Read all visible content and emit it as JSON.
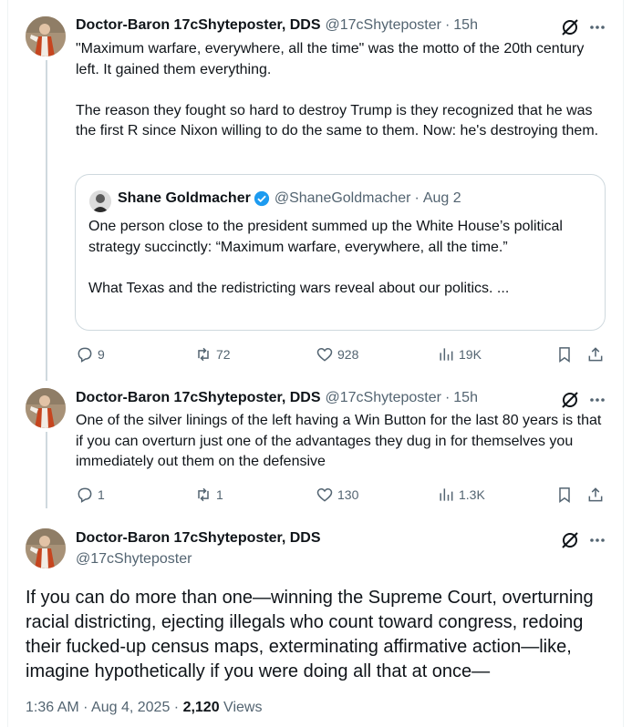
{
  "tweets": [
    {
      "name": "Doctor-Baron 17cShyteposter, DDS",
      "handle": "@17cShyteposter",
      "sep": "·",
      "time": "15h",
      "text": "\"Maximum warfare, everywhere, all the time\" was the motto of the 20th century left. It gained them everything.\n\nThe reason they fought so hard to destroy Trump is they recognized that he was the first R since Nixon willing to do the same to them. Now: he's destroying them.",
      "quote": {
        "name": "Shane Goldmacher",
        "handle": "@ShaneGoldmacher",
        "sep": "·",
        "time": "Aug 2",
        "text": "One person close to the president summed up the White House’s political strategy succinctly: “Maximum warfare, everywhere, all the time.”\n\nWhat Texas and the redistricting wars reveal about our politics. ..."
      },
      "stats": {
        "replies": "9",
        "reposts": "72",
        "likes": "928",
        "views": "19K"
      }
    },
    {
      "name": "Doctor-Baron 17cShyteposter, DDS",
      "handle": "@17cShyteposter",
      "sep": "·",
      "time": "15h",
      "text": "One of the silver linings of the left having a Win Button for the last 80 years is that if you can overturn just one of the advantages they dug in for themselves you immediately out them on the defensive",
      "stats": {
        "replies": "1",
        "reposts": "1",
        "likes": "130",
        "views": "1.3K"
      }
    }
  ],
  "main": {
    "name": "Doctor-Baron 17cShyteposter, DDS",
    "handle": "@17cShyteposter",
    "text": "If you can do more than one—winning the Supreme Court, overturning racial districting, ejecting illegals who count toward congress, redoing their fucked-up census maps, exterminating affirmative action—like, imagine hypothetically if you were doing all that at once—",
    "timestamp": "1:36 AM · Aug 4, 2025 · ",
    "views_count": "2,120",
    "views_label": " Views"
  },
  "colors": {
    "text": "#0f1419",
    "secondary": "#536471",
    "border": "#cfd9de",
    "verified": "#1d9bf0"
  }
}
